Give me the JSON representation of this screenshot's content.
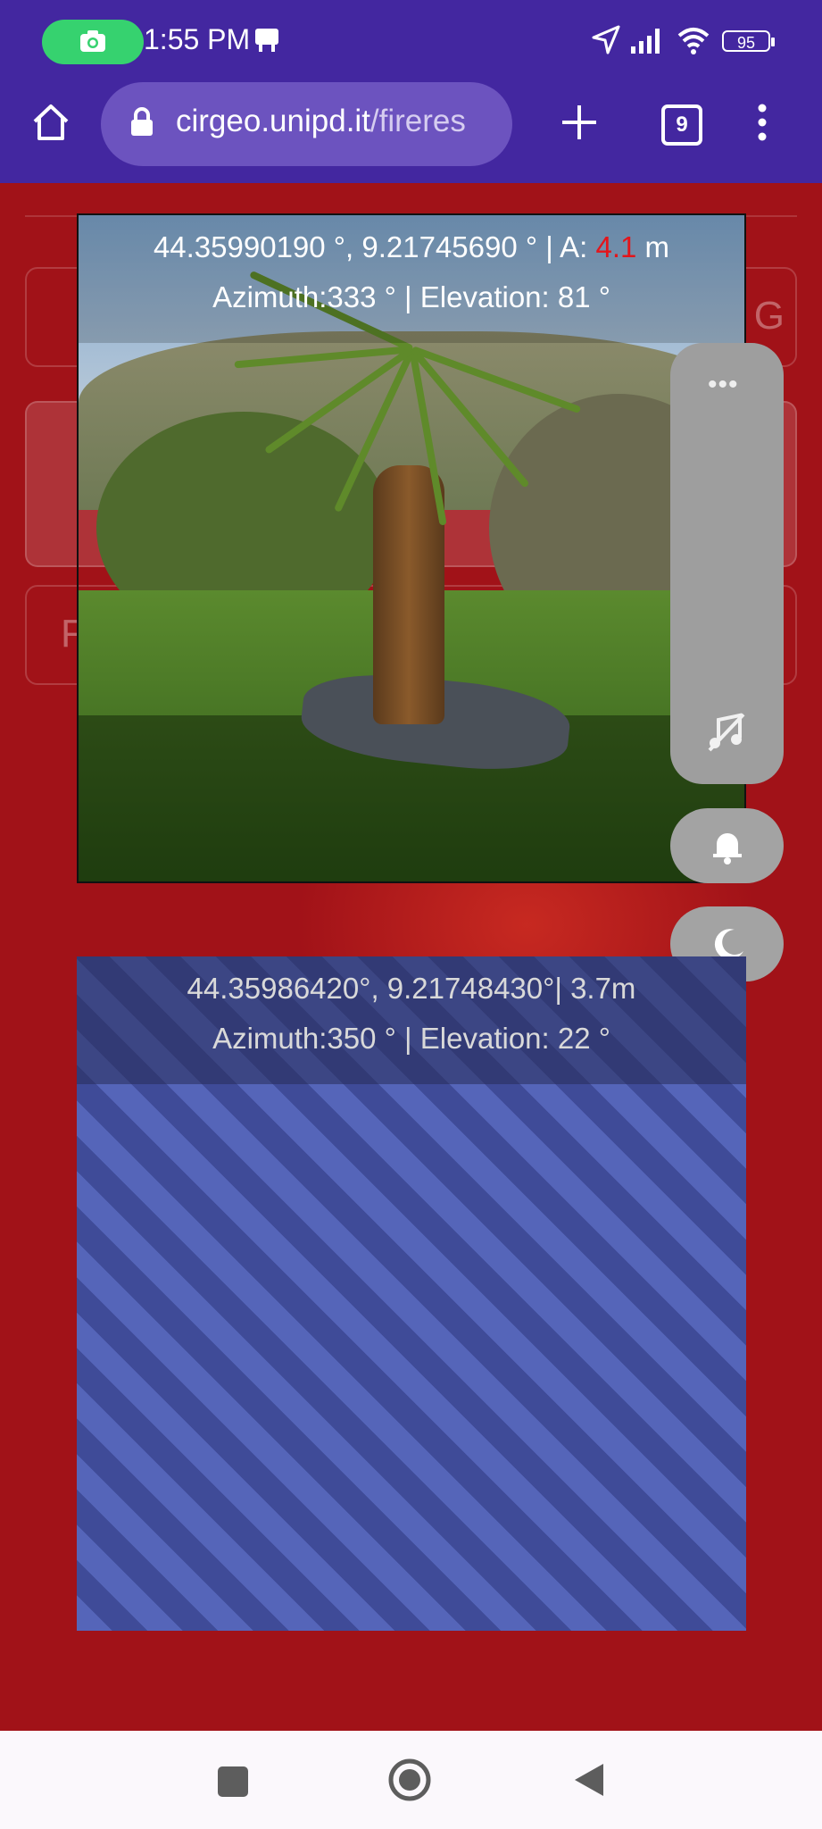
{
  "status_bar": {
    "time": "1:55 PM",
    "battery": "95",
    "icons": [
      "screen-recorder-icon",
      "notification-icon",
      "location-arrow-icon",
      "signal-icon",
      "wifi-icon",
      "battery-icon"
    ]
  },
  "browser": {
    "url_domain": "cirgeo.unipd.it",
    "url_path": "/fireres",
    "tab_count": "9"
  },
  "camera": {
    "coords": "44.35990190 °, 9.21745690 ° | A: ",
    "accuracy": "4.1",
    "unit": " m",
    "orientation": "Azimuth:333 ° |  Elevation: 81 °"
  },
  "map": {
    "coords": "44.35986420°, 9.21748430°|  3.7m",
    "orientation": "Azimuth:350 ° |  Elevation: 22 °"
  },
  "tools": {
    "more": "•••",
    "icons": [
      "more-icon",
      "music-off-icon",
      "bell-icon",
      "moon-icon"
    ]
  },
  "background_fragments": {
    "left_letter": "F",
    "right_letter": "G"
  },
  "colors": {
    "status_bar": "#4327a0",
    "page_background": "#a11218",
    "accuracy_red": "#e3151b"
  }
}
